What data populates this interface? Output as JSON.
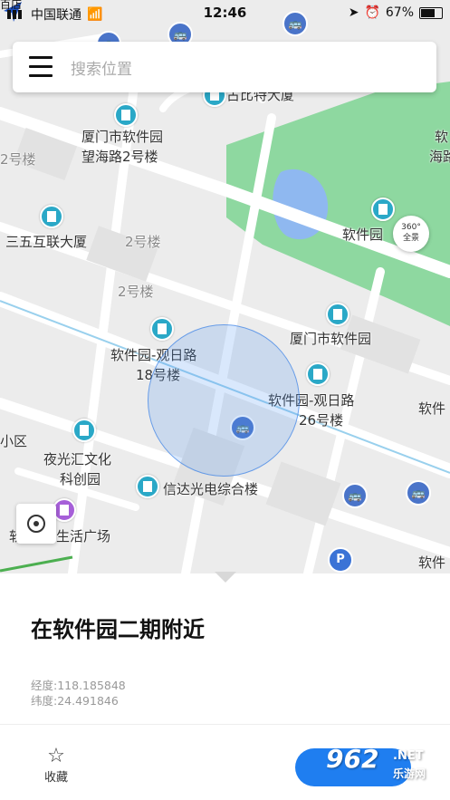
{
  "status_bar": {
    "top_left_fragment": "百店",
    "carrier": "中国联通",
    "time": "12:46",
    "battery": "67%",
    "battery_level": 0.67
  },
  "search": {
    "placeholder": "搜索位置"
  },
  "map": {
    "labels": {
      "gubite": "古比特大厦",
      "xm_software_park_line1": "厦门市软件园",
      "xm_software_park_line2": "望海路2号楼",
      "edge_right_line1": "软",
      "edge_right_line2": "海路",
      "sanwu": "三五互联大厦",
      "bldg2_a": "2号楼",
      "bldg2_b": "2号楼",
      "bldg2_left": "2号楼",
      "park_name": "软件园",
      "guanri18_line1": "软件园-观日路",
      "guanri18_line2": "18号楼",
      "xm_software_park": "厦门市软件园",
      "guanri26_line1": "软件园-观日路",
      "guanri26_line2": "26号楼",
      "edge_ruanjian": "软件",
      "xiaoqu": "小区",
      "yeguanghui_line1": "夜光汇文化",
      "yeguanghui_line2": "科创园",
      "xinda": "信达光电综合楼",
      "life_plaza": "生活广场",
      "edge_left_char": "软",
      "edge_bottom_right": "软件"
    },
    "btn_360_line1": "360°",
    "btn_360_line2": "全景",
    "colors": {
      "park": "#8ed8a0",
      "water": "#8fb8f0",
      "road": "#ffffff",
      "ground": "#ececec"
    }
  },
  "panel": {
    "place": "在软件园二期附近",
    "longitude": "经度:118.185848",
    "latitude": "纬度:24.491846",
    "favorite_label": "收藏",
    "watermark_brand": "962",
    "watermark_net": ".NET",
    "watermark_site": "乐游网"
  }
}
